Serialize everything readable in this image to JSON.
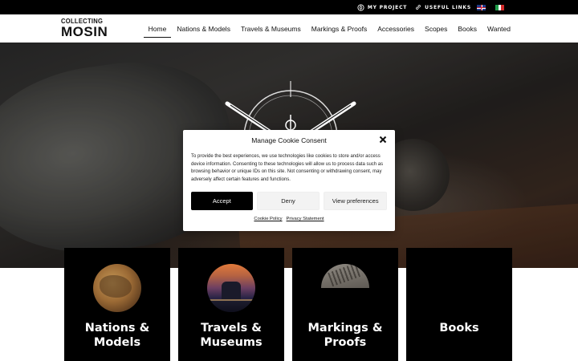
{
  "topbar": {
    "links": [
      {
        "label": "MY PROJECT",
        "icon": "crosshair-icon"
      },
      {
        "label": "USEFUL LINKS",
        "icon": "link-icon"
      }
    ],
    "languages": [
      {
        "code": "en",
        "icon": "uk-flag-icon"
      },
      {
        "code": "it",
        "icon": "italy-flag-icon"
      }
    ]
  },
  "header": {
    "logo_top": "COLLECTING",
    "logo_bottom": "MOSIN",
    "nav": [
      {
        "label": "Home",
        "active": true
      },
      {
        "label": "Nations & Models"
      },
      {
        "label": "Travels & Museums"
      },
      {
        "label": "Markings & Proofs"
      },
      {
        "label": "Accessories"
      },
      {
        "label": "Scopes"
      },
      {
        "label": "Books"
      },
      {
        "label": "Wanted"
      }
    ]
  },
  "cookie": {
    "title": "Manage Cookie Consent",
    "text": "To provide the best experiences, we use technologies like cookies to store and/or access device information. Consenting to these technologies will allow us to process data such as browsing behavior or unique IDs on this site. Not consenting or withdrawing consent, may adversely affect certain features and functions.",
    "accept": "Accept",
    "deny": "Deny",
    "preferences": "View preferences",
    "cookie_policy": "Cookie Policy",
    "privacy_statement": "Privacy Statement"
  },
  "cards": [
    {
      "line1": "Nations &",
      "line2": "Models",
      "image": "globe-image"
    },
    {
      "line1": "Travels &",
      "line2": "Museums",
      "image": "cathedral-image"
    },
    {
      "line1": "Markings &",
      "line2": "Proofs",
      "image": "rifle-marking-image"
    },
    {
      "line1": "Books",
      "line2": "",
      "image": "books-image"
    }
  ],
  "colors": {
    "topbar": "#000000",
    "card": "#000000",
    "accept_button": "#000000",
    "header": "#ffffff"
  }
}
